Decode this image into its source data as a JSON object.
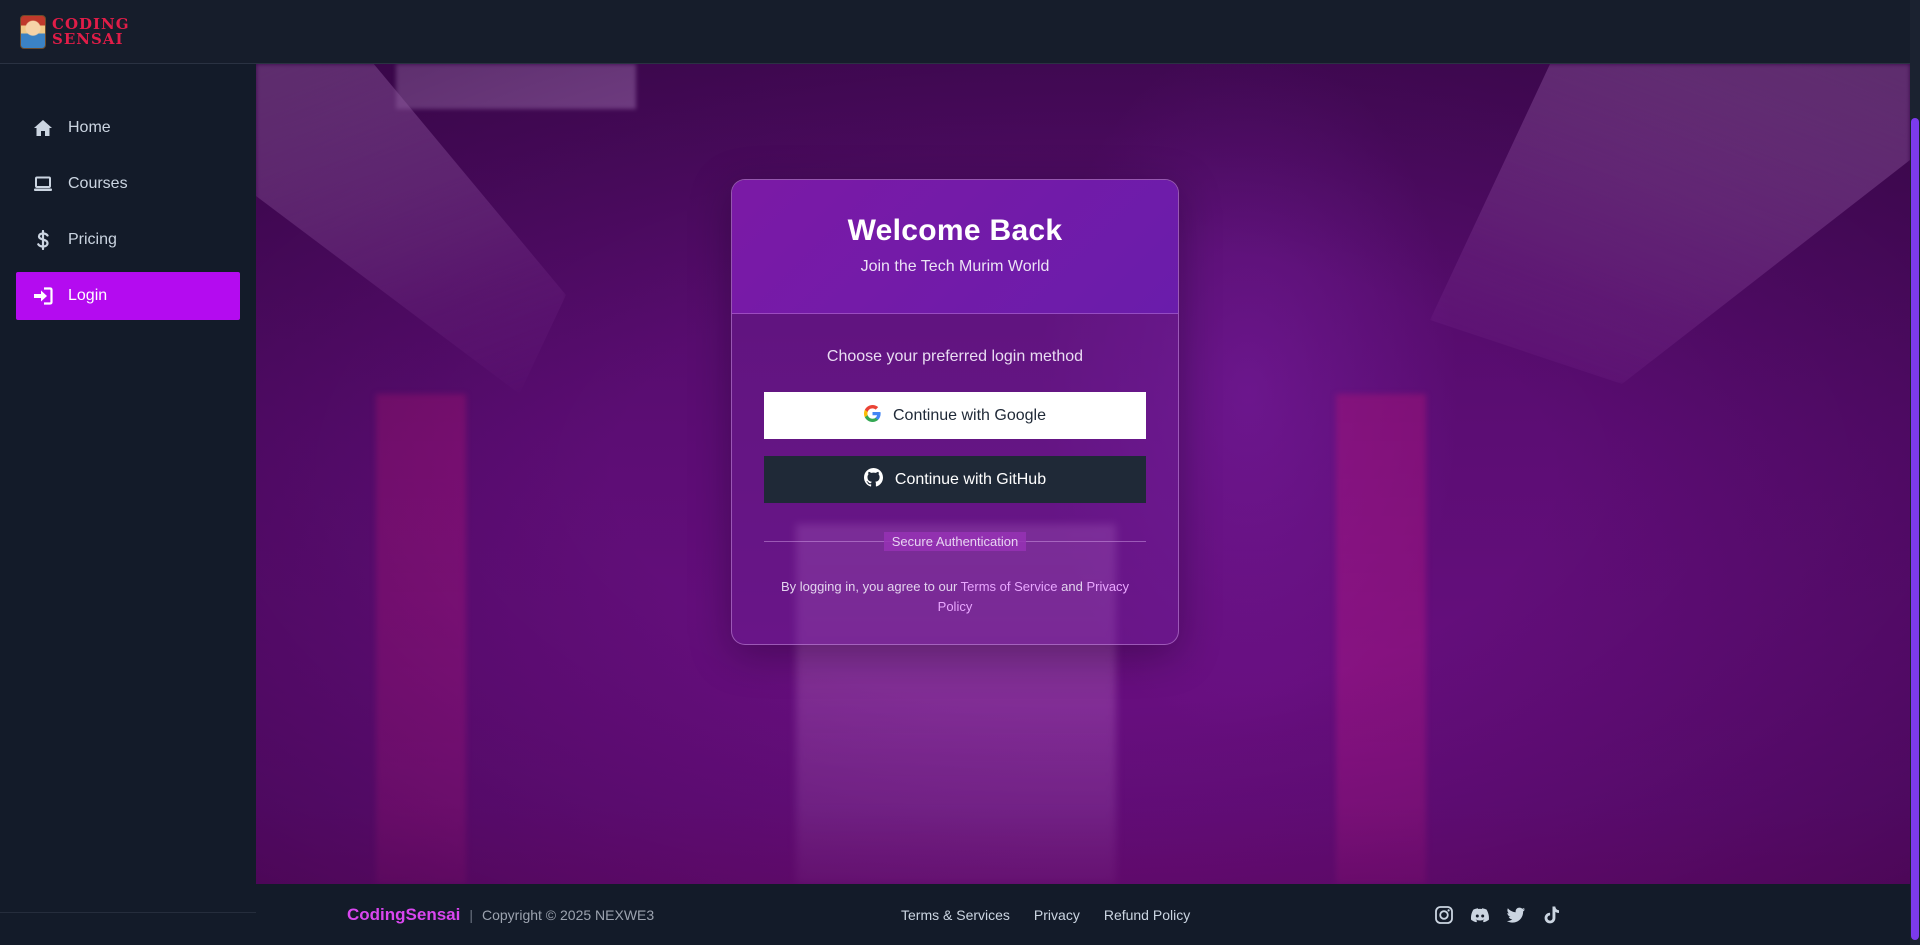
{
  "header": {
    "logo_text_line1": "Coding",
    "logo_text_line2": "Sensai"
  },
  "sidebar": {
    "items": [
      {
        "label": "Home",
        "icon": "home-icon"
      },
      {
        "label": "Courses",
        "icon": "laptop-icon"
      },
      {
        "label": "Pricing",
        "icon": "dollar-icon"
      },
      {
        "label": "Login",
        "icon": "sign-in-icon",
        "active": true
      }
    ]
  },
  "login": {
    "title": "Welcome Back",
    "subtitle": "Join the Tech Murim World",
    "choose_text": "Choose your preferred login method",
    "google_label": "Continue with Google",
    "github_label": "Continue with GitHub",
    "divider_text": "Secure Authentication",
    "legal_prefix": "By logging in, you agree to our",
    "terms_link": "Terms of Service",
    "legal_and": "and",
    "privacy_link": "Privacy Policy"
  },
  "footer": {
    "brand": "CodingSensai",
    "separator": "|",
    "copyright": "Copyright © 2025 NEXWE3",
    "links": [
      "Terms & Services",
      "Privacy",
      "Refund Policy"
    ],
    "socials": [
      "instagram-icon",
      "discord-icon",
      "twitter-icon",
      "tiktok-icon"
    ]
  },
  "colors": {
    "accent": "#b40bf0",
    "brand": "#d946ef",
    "link": "#e9a7ff"
  }
}
